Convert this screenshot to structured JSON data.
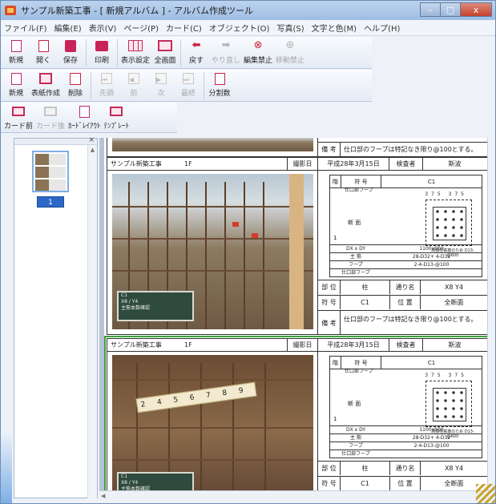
{
  "window": {
    "title": "サンプル新築工事 - [ 新規アルバム ] - アルバム作成ツール",
    "controls": [
      "–",
      "□",
      "x"
    ]
  },
  "menu": [
    "ファイル(F)",
    "編集(E)",
    "表示(V)",
    "ページ(P)",
    "カード(C)",
    "オブジェクト(O)",
    "写真(S)",
    "文字と色(M)",
    "ヘルプ(H)"
  ],
  "toolbar1": [
    "新規",
    "開く",
    "保存",
    "印刷",
    "表示設定",
    "全画面",
    "戻す",
    "やり直し",
    "編集禁止",
    "移動禁止"
  ],
  "toolbar2": [
    "新規",
    "表紙作成",
    "削除",
    "先頭",
    "前",
    "次",
    "最終",
    "分割数"
  ],
  "toolbar3": [
    "カード前",
    "カード後",
    "ｶｰﾄﾞﾚｲｱｳﾄ",
    "ﾃﾝﾌﾟﾚｰﾄ"
  ],
  "thumbnail": {
    "page_number": "1"
  },
  "top_card": {
    "remarks_label": "備 考",
    "remarks": "仕口部のフープは特記なき限り@100とする。"
  },
  "card1": {
    "project": "サンプル新築工事",
    "floor": "1F",
    "date_label": "撮影日",
    "date": "平成28年3月15日",
    "inspector_label": "検査者",
    "inspector": "斯波",
    "spec": {
      "head_a": "階",
      "head_b": "符 号",
      "code": "C1",
      "sub": "仕口部フープ",
      "section": "断 面",
      "row_num": "1",
      "dims": "375  375",
      "note": "高額柱鉄筋のため D13-@600",
      "rows": [
        [
          "DX x DY",
          "1100x900"
        ],
        [
          "主 筋",
          "28-D32+ 4-D32"
        ],
        [
          "フープ",
          "2-4-D13-@100"
        ],
        [
          "仕口部フープ",
          ""
        ]
      ]
    },
    "position_label": "部 位",
    "position": "柱",
    "grid_label": "通り名",
    "grid": "X8 Y4",
    "code_label": "符 号",
    "code": "C1",
    "location_label": "位 置",
    "location": "全断面",
    "remarks_label": "備 考",
    "remarks": "仕口部のフープは特記なき限り@100とする。",
    "board": [
      "C1",
      "X8 / Y4",
      "主筋本数確認"
    ]
  },
  "card2": {
    "project": "サンプル新築工事",
    "floor": "1F",
    "date_label": "撮影日",
    "date": "平成28年3月15日",
    "inspector_label": "検査者",
    "inspector": "斯波",
    "spec": {
      "head_a": "階",
      "head_b": "符 号",
      "code": "C1",
      "sub": "仕口部フープ",
      "section": "断 面",
      "row_num": "1",
      "dims": "375  375",
      "note": "高額柱鉄筋のため D13-@600",
      "rows": [
        [
          "DX x DY",
          "1100x900"
        ],
        [
          "主 筋",
          "28-D32+ 4-D32"
        ],
        [
          "フープ",
          "2-4-D13-@100"
        ],
        [
          "仕口部フープ",
          ""
        ]
      ]
    },
    "position_label": "部 位",
    "position": "柱",
    "grid_label": "通り名",
    "grid": "X8 Y4",
    "code_label": "符 号",
    "code": "C1",
    "location_label": "位 置",
    "location": "全断面",
    "tape": "2 4 5 6 7 8 9",
    "board": [
      "C1",
      "X8 / Y4",
      "主筋本数確認"
    ]
  }
}
